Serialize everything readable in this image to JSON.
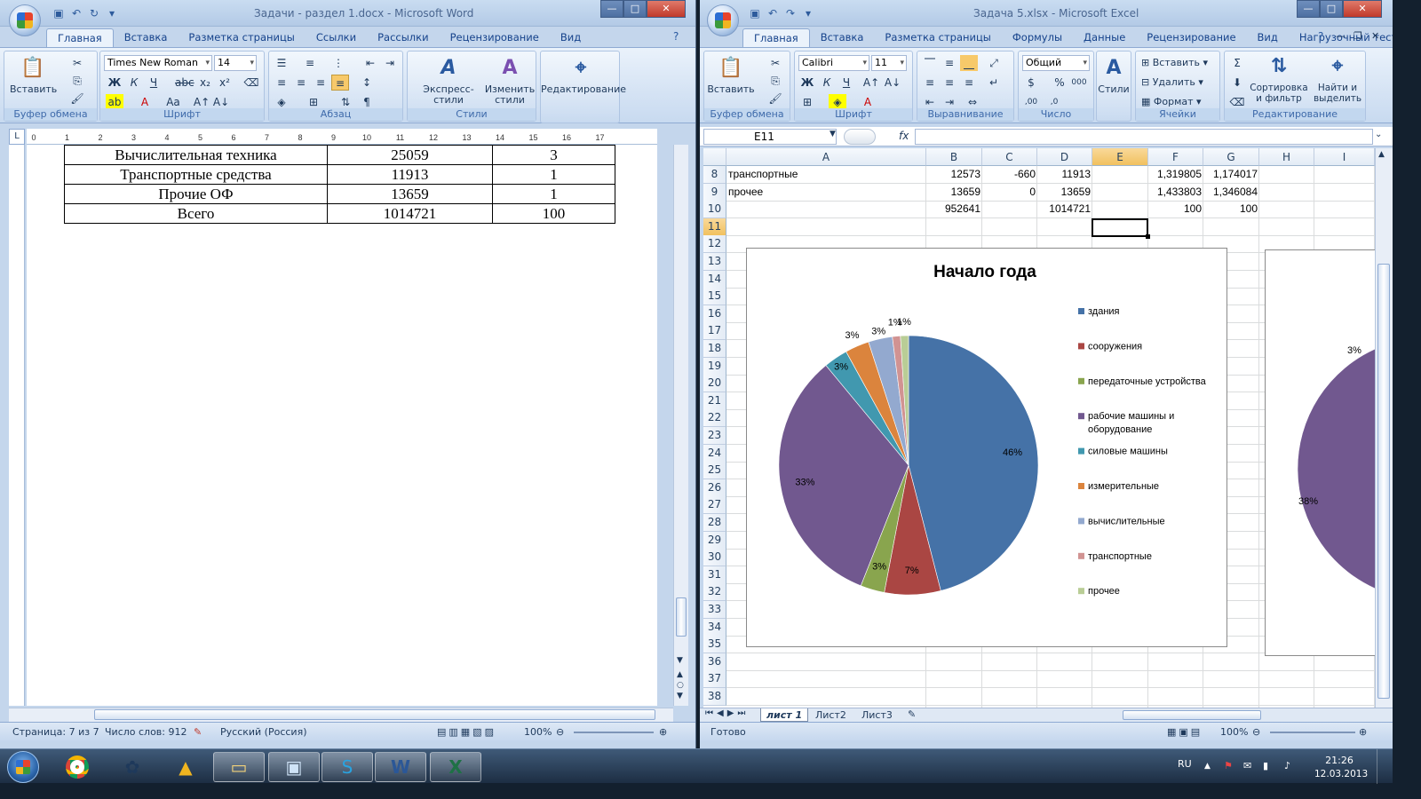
{
  "word": {
    "title": "Задачи - раздел 1.docx - Microsoft Word",
    "tabs": [
      "Главная",
      "Вставка",
      "Разметка страницы",
      "Ссылки",
      "Рассылки",
      "Рецензирование",
      "Вид"
    ],
    "font_name": "Times New Roman",
    "font_size": "14",
    "groups": {
      "clipboard": "Буфер обмена",
      "font": "Шрифт",
      "paragraph": "Абзац",
      "styles": "Стили"
    },
    "paste_label": "Вставить",
    "quick_styles": "Экспресс-стили",
    "change_styles": "Изменить стили",
    "editing": "Редактирование",
    "table": [
      [
        "Вычислительная техника",
        "25059",
        "3"
      ],
      [
        "Транспортные средства",
        "11913",
        "1"
      ],
      [
        "Прочие ОФ",
        "13659",
        "1"
      ],
      [
        "Всего",
        "1014721",
        "100"
      ]
    ],
    "status": {
      "page": "Страница: 7 из 7",
      "words": "Число слов: 912",
      "lang": "Русский (Россия)",
      "zoom": "100%"
    }
  },
  "excel": {
    "title": "Задача 5.xlsx - Microsoft Excel",
    "tabs": [
      "Главная",
      "Вставка",
      "Разметка страницы",
      "Формулы",
      "Данные",
      "Рецензирование",
      "Вид",
      "Нагрузочный тест"
    ],
    "font_name": "Calibri",
    "font_size": "11",
    "number_format": "Общий",
    "groups": {
      "clipboard": "Буфер обмена",
      "font": "Шрифт",
      "align": "Выравнивание",
      "number": "Число",
      "cells": "Ячейки",
      "editing": "Редактирование"
    },
    "paste_label": "Вставить",
    "styles_label": "Стили",
    "cells_btns": [
      "Вставить",
      "Удалить",
      "Формат"
    ],
    "sort_label": "Сортировка и фильтр",
    "find_label": "Найти и выделить",
    "name_box": "E11",
    "fx": "fx",
    "columns": [
      "A",
      "B",
      "C",
      "D",
      "E",
      "F",
      "G",
      "H",
      "I"
    ],
    "rows": [
      {
        "n": "8",
        "a": "транспортные",
        "b": "12573",
        "c": "-660",
        "d": "11913",
        "e": "",
        "f": "1,319805",
        "g": "1,174017"
      },
      {
        "n": "9",
        "a": "прочее",
        "b": "13659",
        "c": "0",
        "d": "13659",
        "e": "",
        "f": "1,433803",
        "g": "1,346084"
      },
      {
        "n": "10",
        "a": "",
        "b": "952641",
        "c": "",
        "d": "1014721",
        "e": "",
        "f": "100",
        "g": "100"
      }
    ],
    "row_numbers": [
      "11",
      "12",
      "13",
      "14",
      "15",
      "16",
      "17",
      "18",
      "19",
      "20",
      "21",
      "22",
      "23",
      "24",
      "25",
      "26",
      "27",
      "28",
      "29",
      "30",
      "31",
      "32",
      "33",
      "34",
      "35",
      "36",
      "37",
      "38"
    ],
    "sheets": [
      "лист 1",
      "Лист2",
      "Лист3"
    ],
    "status": {
      "ready": "Готово",
      "zoom": "100%"
    }
  },
  "chart_data": [
    {
      "type": "pie",
      "title": "Начало года",
      "categories": [
        "здания",
        "сооружения",
        "передаточные устройства",
        "рабочие машины и оборудование",
        "силовые машины",
        "измерительные",
        "вычислительные",
        "транспортные",
        "прочее"
      ],
      "values": [
        46,
        7,
        3,
        33,
        3,
        3,
        3,
        1,
        1
      ],
      "data_labels": [
        "46%",
        "7%",
        "3%",
        "33%",
        "3%",
        "3%",
        "3%",
        "1%",
        "1%"
      ],
      "colors": [
        "#4572a7",
        "#aa4643",
        "#89a54e",
        "#71588f",
        "#4198af",
        "#db843d",
        "#93a9cf",
        "#d19392",
        "#b9cd96"
      ],
      "legend": "right"
    },
    {
      "type": "pie",
      "title": "",
      "partial": true,
      "data_labels": [
        "3%",
        "38%"
      ]
    }
  ],
  "taskbar": {
    "lang": "RU",
    "time": "21:26",
    "date": "12.03.2013"
  }
}
